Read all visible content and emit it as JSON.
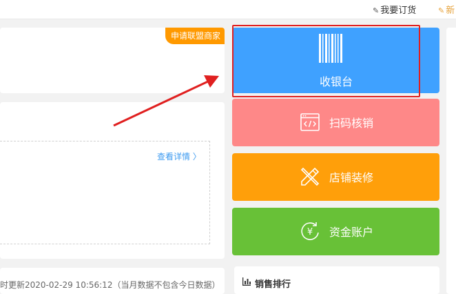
{
  "topbar": {
    "order_label": "我要订货",
    "order_icon": "edit-icon",
    "new_label": "新",
    "new_icon": "note-icon"
  },
  "merchant_card": {
    "badge_label": "申请联盟商家"
  },
  "stats_card": {
    "detail_link": "查看详情 〉"
  },
  "update_bar": {
    "text": "时更新2020-02-29 10:56:12（当月数据不包含今日数据）"
  },
  "tiles": {
    "cashier": {
      "label": "收银台",
      "icon": "barcode-icon",
      "color": "#3fa1ff"
    },
    "scan": {
      "label": "扫码核销",
      "icon": "code-window-icon",
      "color": "#fe8888"
    },
    "decor": {
      "label": "店铺装修",
      "icon": "pencil-ruler-icon",
      "color": "#ff9f0a"
    },
    "fund": {
      "label": "资金账户",
      "icon": "yuan-cycle-icon",
      "color": "#68c137"
    }
  },
  "ranking": {
    "title": "销售排行",
    "icon": "bar-chart-icon"
  },
  "annotation": {
    "highlight_color": "#e02020"
  }
}
